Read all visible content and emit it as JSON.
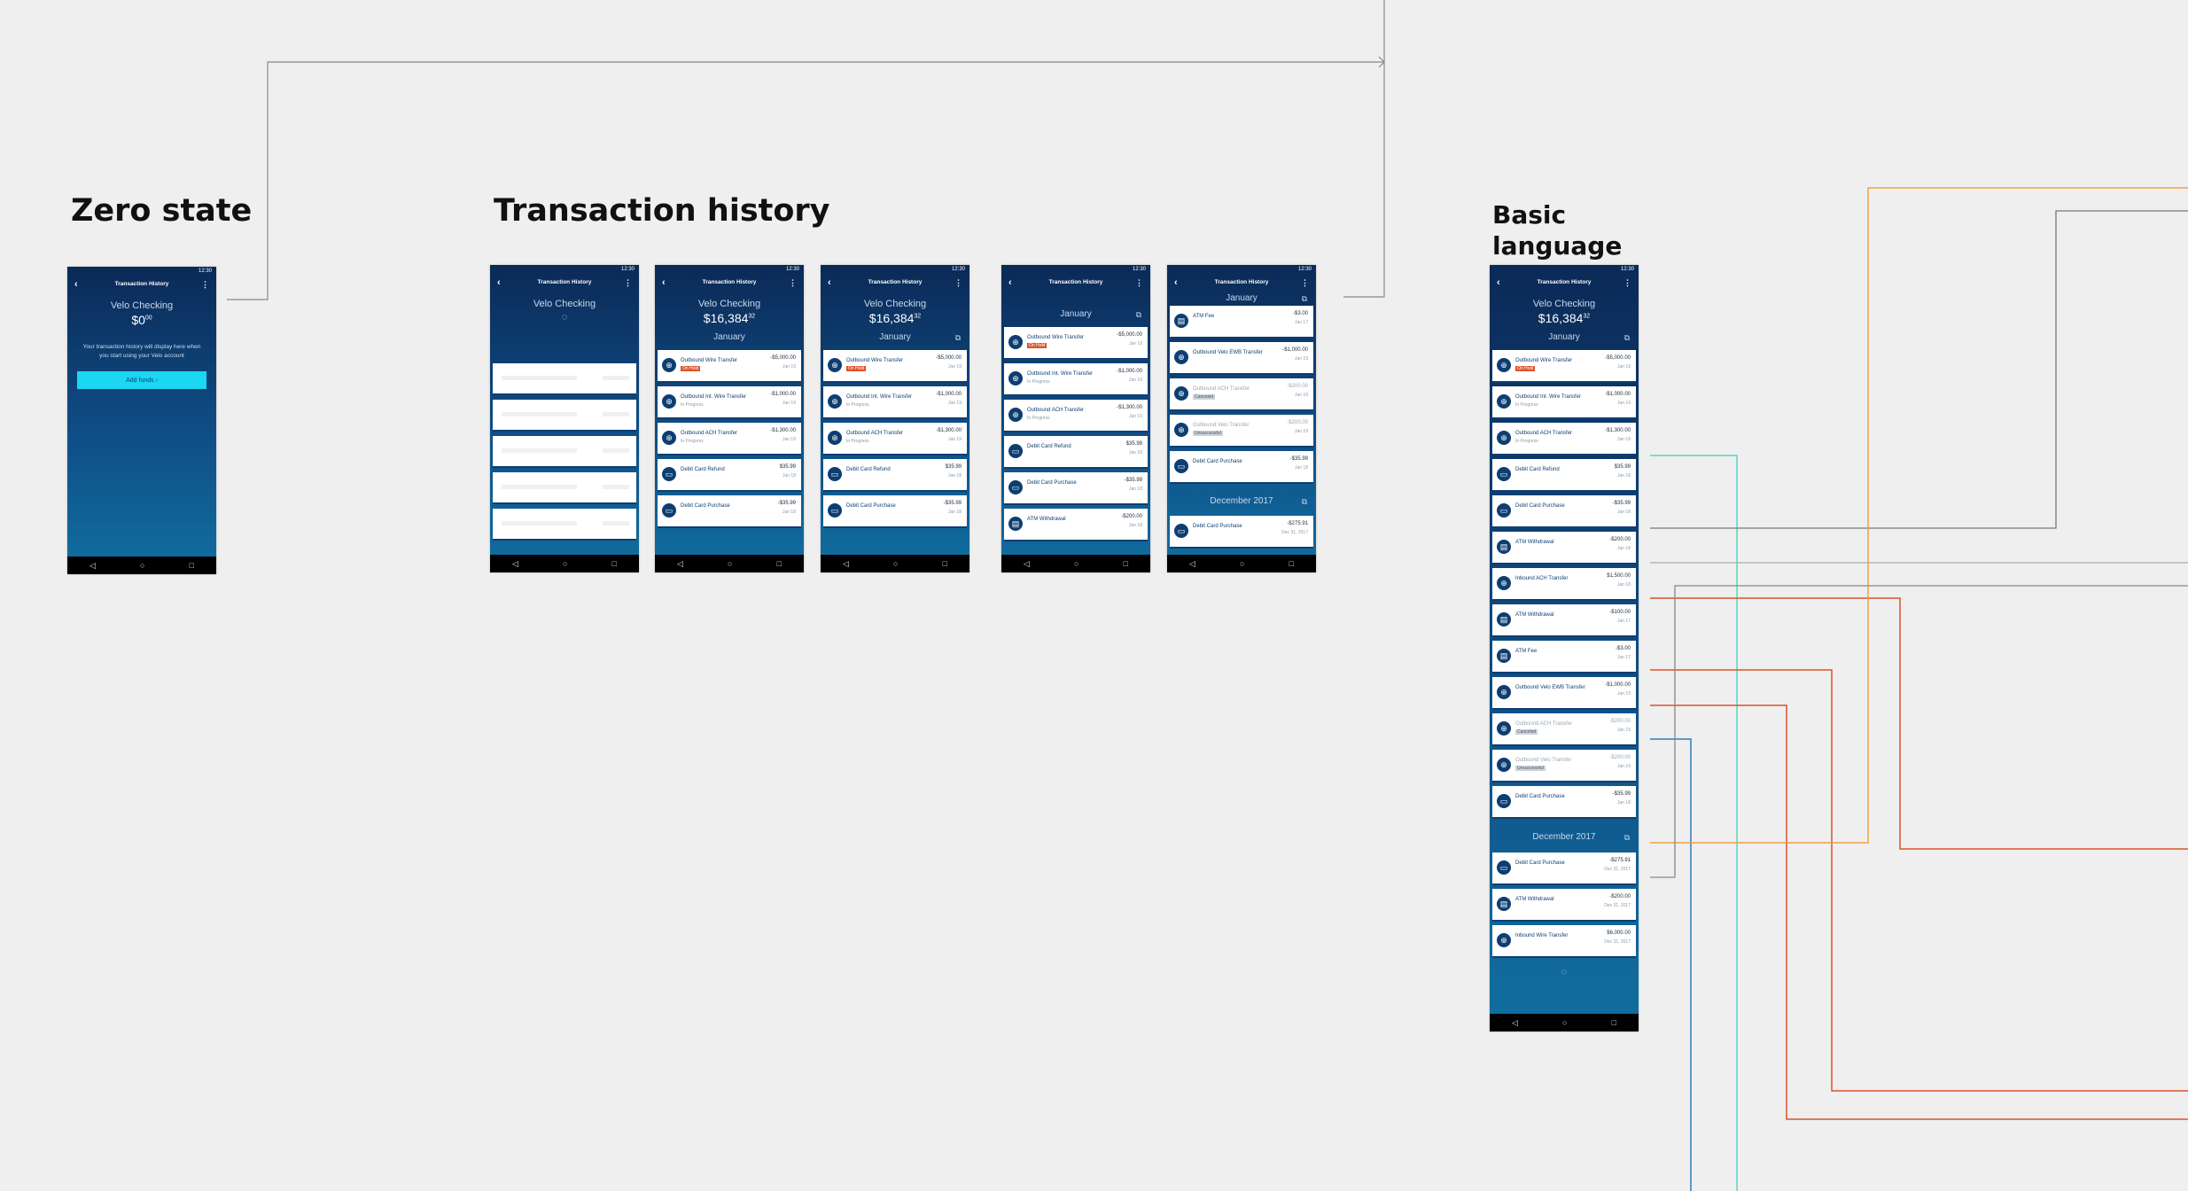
{
  "sections": {
    "zero_state": "Zero state",
    "transaction_history": "Transaction history",
    "basic_language": "Basic language"
  },
  "app": {
    "screen_title": "Transaction History",
    "status_time": "12:30",
    "account_name": "Velo Checking",
    "balance_main": "$16,384",
    "balance_cents": "32",
    "zero_balance_main": "$0",
    "zero_balance_cents": "00",
    "zero_message": "Your transaction history will display here when you start using your Velo account",
    "add_funds": "Add funds ›",
    "month_january": "January",
    "month_december": "December 2017"
  },
  "colors": {
    "brand_dark": "#0b2a57",
    "accent_cyan": "#1ad7f2",
    "failed": "#e0522a"
  },
  "transactions": [
    {
      "name": "Outbound Wire Transfer",
      "sub": "On Hold",
      "amt": "-$5,000.00",
      "date": "Jan 19",
      "icon": "globe-icon"
    },
    {
      "name": "Outbound Int. Wire Transfer",
      "sub": "In Progress",
      "amt": "-$1,000.00",
      "date": "Jan 19",
      "icon": "globe-icon"
    },
    {
      "name": "Outbound ACH Transfer",
      "sub": "In Progress",
      "amt": "-$1,300.00",
      "date": "Jan 19",
      "icon": "globe-icon"
    },
    {
      "name": "Debit Card Refund",
      "sub": "",
      "amt": "$35.99",
      "date": "Jan 18",
      "icon": "card-icon"
    },
    {
      "name": "Debit Card Purchase",
      "sub": "",
      "amt": "-$35.99",
      "date": "Jan 18",
      "icon": "card-icon"
    },
    {
      "name": "ATM Withdrawal",
      "sub": "",
      "amt": "-$200.00",
      "date": "Jan 18",
      "icon": "atm-icon"
    },
    {
      "name": "Inbound ACH Transfer",
      "sub": "",
      "amt": "$1,500.00",
      "date": "Jan 18",
      "icon": "globe-icon"
    },
    {
      "name": "ATM Withdrawal",
      "sub": "",
      "amt": "-$100.00",
      "date": "Jan 17",
      "icon": "atm-icon"
    },
    {
      "name": "ATM Fee",
      "sub": "",
      "amt": "-$3.00",
      "date": "Jan 17",
      "icon": "atm-icon"
    },
    {
      "name": "Outbound Velo EWB Transfer",
      "sub": "",
      "amt": "-$1,000.00",
      "date": "Jan 19",
      "icon": "globe-icon"
    },
    {
      "name": "Outbound ACH Transfer",
      "sub": "Canceled",
      "amt": "-$200.00",
      "date": "Jan 19",
      "icon": "globe-icon"
    },
    {
      "name": "Outbound Velo Transfer",
      "sub": "Unsuccessful",
      "amt": "-$200.00",
      "date": "Jan 19",
      "icon": "globe-icon"
    },
    {
      "name": "Debit Card Purchase",
      "sub": "",
      "amt": "-$35.99",
      "date": "Jan 18",
      "icon": "card-icon"
    },
    {
      "name": "Debit Card Purchase",
      "sub": "",
      "amt": "-$275.91",
      "date": "Dec 31, 2017",
      "icon": "card-icon"
    },
    {
      "name": "ATM Withdrawal",
      "sub": "",
      "amt": "-$200.00",
      "date": "Dec 31, 2017",
      "icon": "atm-icon"
    },
    {
      "name": "Inbound Wire Transfer",
      "sub": "",
      "amt": "$6,000.00",
      "date": "Dec 31, 2017",
      "icon": "globe-icon"
    }
  ]
}
